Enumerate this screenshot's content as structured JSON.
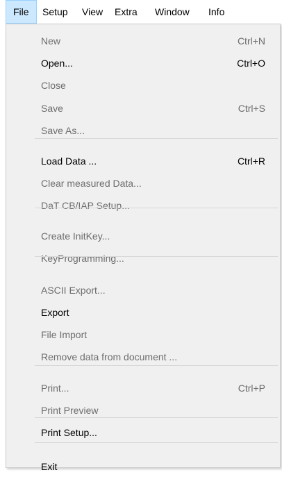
{
  "menubar": {
    "items": [
      {
        "label": "File",
        "active": true
      },
      {
        "label": "Setup"
      },
      {
        "label": "View"
      },
      {
        "label": "Extra"
      },
      {
        "label": "Window"
      },
      {
        "label": "Info"
      }
    ]
  },
  "file_menu": {
    "groups": [
      [
        {
          "label": "New",
          "shortcut": "Ctrl+N",
          "enabled": false
        },
        {
          "label": "Open...",
          "shortcut": "Ctrl+O",
          "enabled": true
        },
        {
          "label": "Close",
          "shortcut": "",
          "enabled": false
        },
        {
          "label": "Save",
          "shortcut": "Ctrl+S",
          "enabled": false
        },
        {
          "label": "Save As...",
          "shortcut": "",
          "enabled": false
        }
      ],
      [
        {
          "label": "Load Data ...",
          "shortcut": "Ctrl+R",
          "enabled": true
        },
        {
          "label": "Clear measured Data...",
          "shortcut": "",
          "enabled": false
        },
        {
          "label": "DaT CB/IAP Setup...",
          "shortcut": "",
          "enabled": false
        }
      ],
      [
        {
          "label": "Create InitKey...",
          "shortcut": "",
          "enabled": false
        },
        {
          "label": "KeyProgramming...",
          "shortcut": "",
          "enabled": false
        }
      ],
      [
        {
          "label": "ASCII Export...",
          "shortcut": "",
          "enabled": false
        },
        {
          "label": "Export",
          "shortcut": "",
          "enabled": true
        },
        {
          "label": "File Import",
          "shortcut": "",
          "enabled": false
        },
        {
          "label": "Remove data from document ...",
          "shortcut": "",
          "enabled": false
        }
      ],
      [
        {
          "label": "Print...",
          "shortcut": "Ctrl+P",
          "enabled": false
        },
        {
          "label": "Print Preview",
          "shortcut": "",
          "enabled": false
        },
        {
          "label": "Print Setup...",
          "shortcut": "",
          "enabled": true
        }
      ],
      [
        {
          "label": "Exit",
          "shortcut": "",
          "enabled": true
        }
      ]
    ]
  }
}
